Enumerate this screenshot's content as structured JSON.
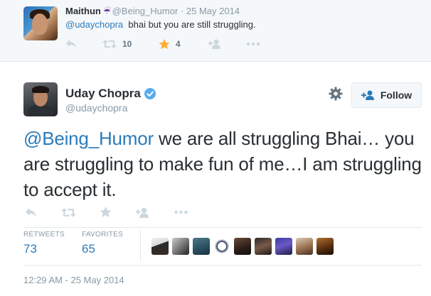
{
  "reply_tweet": {
    "name": "Maithun",
    "handle": "@Being_Humor",
    "separator": "·",
    "date": "25 May 2014",
    "mention": "@udaychopra",
    "body": "bhai but you are still struggling.",
    "retweet_count": "10",
    "favorite_count": "4",
    "icons": [
      "reply-icon",
      "retweet-icon",
      "star-icon",
      "follow-icon",
      "more-icon"
    ],
    "favorited_color": "#ffac33"
  },
  "main_tweet": {
    "name": "Uday Chopra",
    "handle": "@udaychopra",
    "verified": true,
    "follow_label": "Follow",
    "mention": "@Being_Humor",
    "body": " we are all struggling Bhai… you are struggling to make fun of me…I am struggling to accept it.",
    "icons": [
      "reply-icon",
      "retweet-icon",
      "star-icon",
      "follow-icon",
      "more-icon"
    ],
    "stats": {
      "retweets_label": "RETWEETS",
      "retweets_value": "73",
      "favorites_label": "FAVORITES",
      "favorites_value": "65"
    },
    "favoriter_avatar_count": 9,
    "timestamp": "12:29 AM - 25 May 2014"
  },
  "colors": {
    "link": "#2b7bb9",
    "muted": "#8899a6",
    "text": "#292f33",
    "verified": "#55acee",
    "star_active": "#ffac33"
  }
}
